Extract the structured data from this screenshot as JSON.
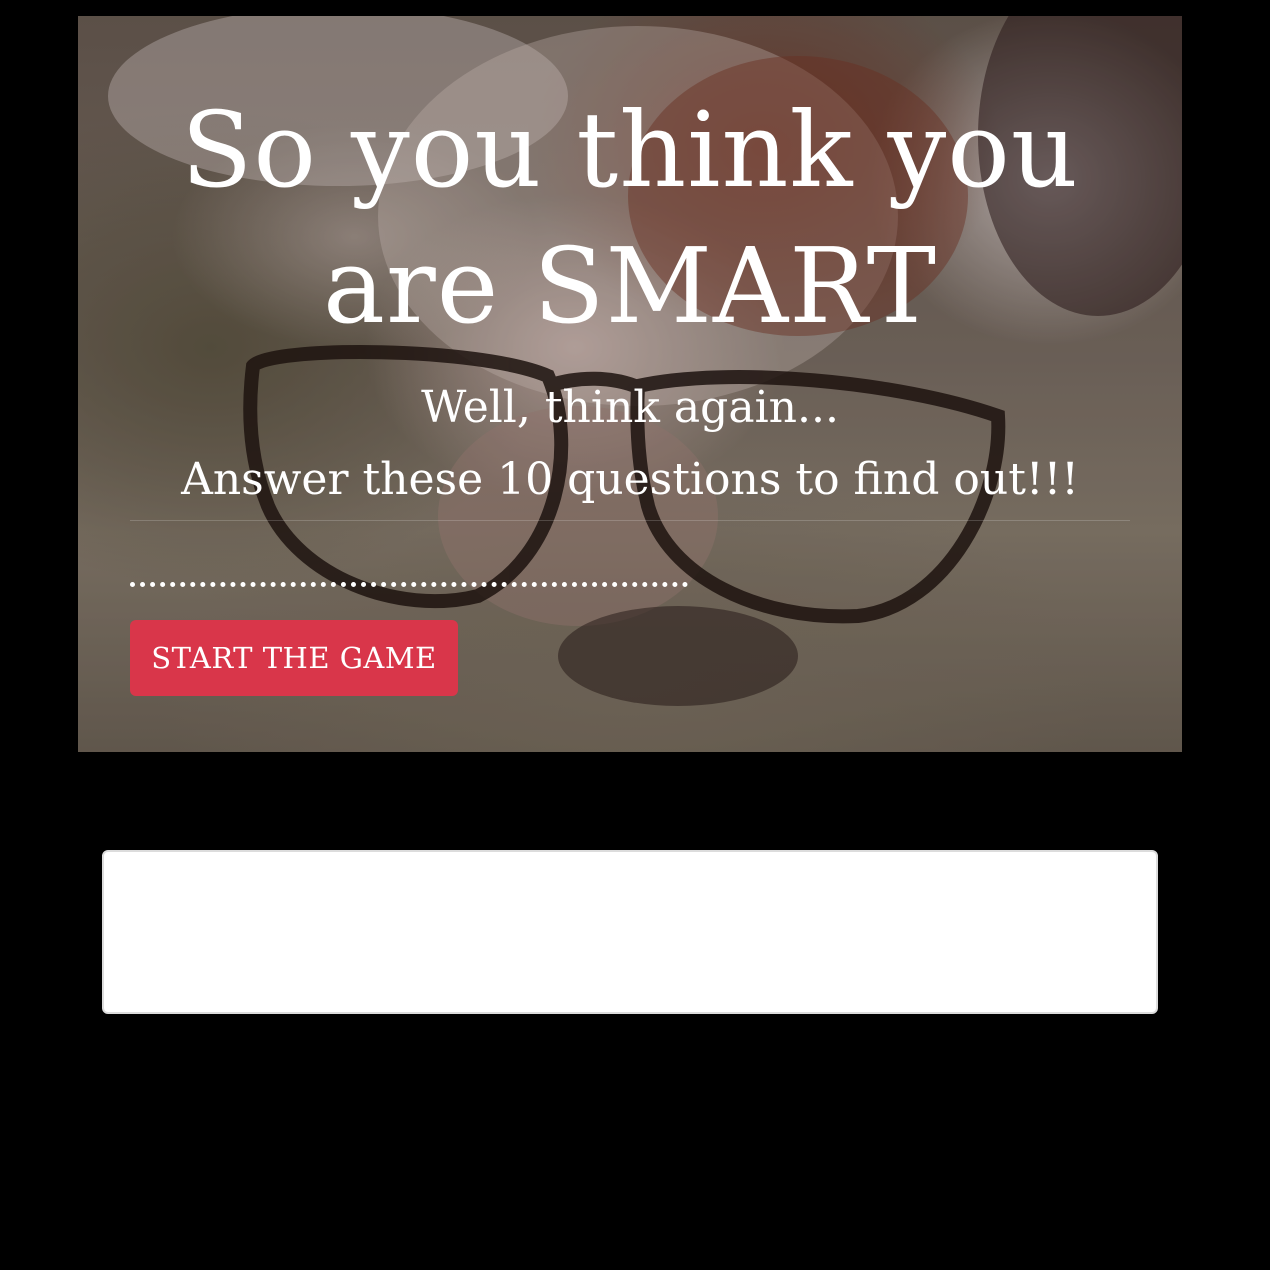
{
  "hero": {
    "title_line_1": "So you think you",
    "title_line_2": "are SMART",
    "subtitle_line_1": "Well, think again...",
    "subtitle_line_2": "Answer these 10 questions to find out!!!",
    "start_button_label": "START THE GAME",
    "background_image": "dog-with-glasses-photo"
  },
  "colors": {
    "page_background": "#000000",
    "button_background": "#d9364a",
    "text": "#ffffff",
    "panel_background": "#ffffff"
  },
  "question_panel": {}
}
